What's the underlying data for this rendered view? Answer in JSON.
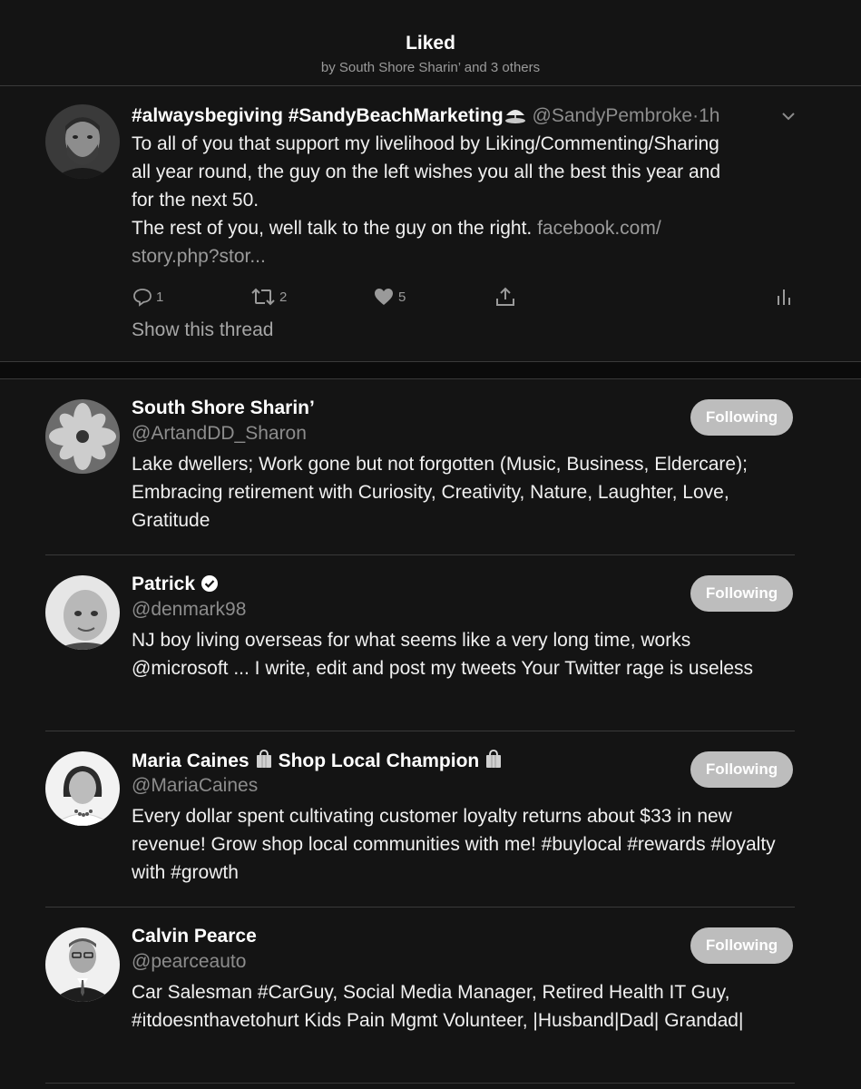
{
  "header": {
    "title": "Liked",
    "subtitle": "by South Shore Sharin’ and 3 others"
  },
  "tweet": {
    "display_name": "#alwaysbegiving #SandyBeachMarketing",
    "name_emoji": "beach-umbrella-icon",
    "handle": "@SandyPembroke",
    "separator": "·",
    "time": "1h",
    "body_lines": [
      "To all of you that support my livelihood by Liking/Commenting/Sharing",
      "all year round, the guy on the left wishes you all the best this year and",
      "for the next 50.",
      "The rest of you, well talk to the guy on the right."
    ],
    "link_text_1": "facebook.com/",
    "link_text_2": "story.php?stor...",
    "replies": "1",
    "retweets": "2",
    "likes": "5",
    "show_thread": "Show this thread"
  },
  "users": [
    {
      "name": "South Shore Sharin’",
      "handle": "@ArtandDD_Sharon",
      "bio": "Lake dwellers; Work gone but not forgotten (Music, Business, Eldercare); Embracing retirement with Curiosity, Creativity, Nature, Laughter, Love, Gratitude",
      "button": "Following"
    },
    {
      "name": "Patrick",
      "handle": "@denmark98",
      "bio": "NJ boy living overseas for what seems like a very long time, works @microsoft ... I write, edit and post my tweets Your Twitter rage is useless",
      "button": "Following",
      "verified": true
    },
    {
      "name_part1": "Maria Caines",
      "name_part2": "Shop Local Champion",
      "handle": "@MariaCaines",
      "bio": "Every dollar spent cultivating customer loyalty returns about $33 in new revenue! Grow shop local communities with me! #buylocal #rewards #loyalty with #growth",
      "button": "Following"
    },
    {
      "name": "Calvin Pearce",
      "handle": "@pearceauto",
      "bio": "Car Salesman #CarGuy, Social Media Manager, Retired Health IT Guy, #itdoesnthavetohurt Kids Pain Mgmt Volunteer, |Husband|Dad| Grandad|",
      "button": "Following"
    }
  ]
}
